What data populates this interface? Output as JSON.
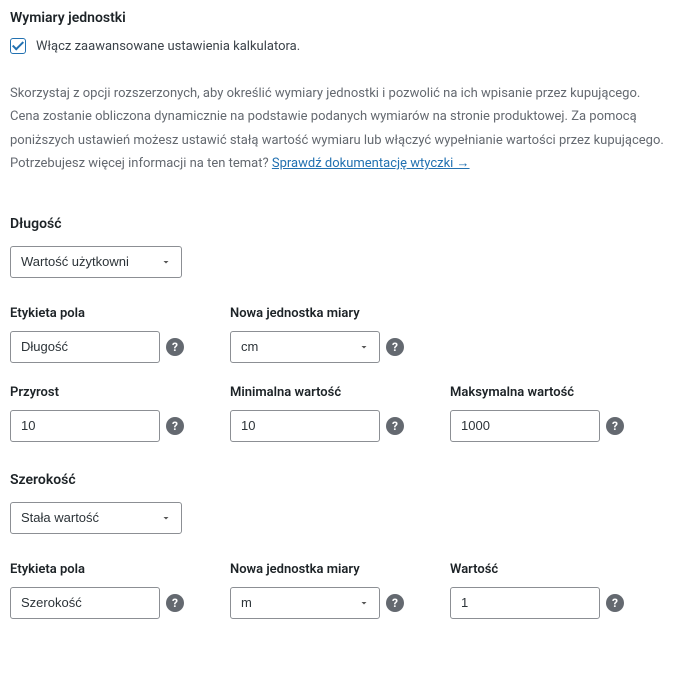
{
  "header": {
    "title": "Wymiary jednostki",
    "checkbox_label": "Włącz zaawansowane ustawienia kalkulatora."
  },
  "description": {
    "text": "Skorzystaj z opcji rozszerzonych, aby określić wymiary jednostki i pozwolić na ich wpisanie przez kupującego. Cena zostanie obliczona dynamicznie na podstawie podanych wymiarów na stronie produktowej. Za pomocą poniższych ustawień możesz ustawić stałą wartość wymiaru lub włączyć wypełnianie wartości przez kupującego. Potrzebujesz więcej informacji na ten temat? ",
    "link_text": "Sprawdź dokumentację wtyczki →"
  },
  "length": {
    "heading": "Długość",
    "mode_select": "Wartość użytkowni",
    "fields": {
      "label_title": "Etykieta pola",
      "label_value": "Długość",
      "unit_title": "Nowa jednostka miary",
      "unit_value": "cm",
      "increment_title": "Przyrost",
      "increment_value": "10",
      "min_title": "Minimalna wartość",
      "min_value": "10",
      "max_title": "Maksymalna wartość",
      "max_value": "1000"
    }
  },
  "width": {
    "heading": "Szerokość",
    "mode_select": "Stała wartość",
    "fields": {
      "label_title": "Etykieta pola",
      "label_value": "Szerokość",
      "unit_title": "Nowa jednostka miary",
      "unit_value": "m",
      "value_title": "Wartość",
      "value_value": "1"
    }
  }
}
